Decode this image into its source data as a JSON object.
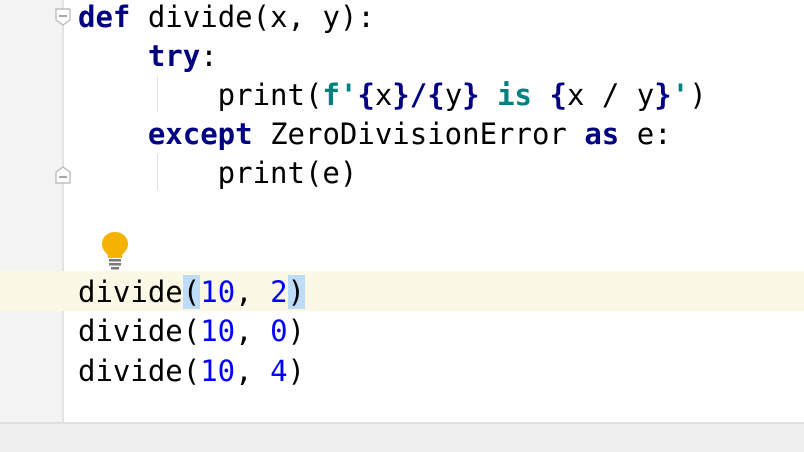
{
  "editor": {
    "lines": [
      [
        {
          "t": "def",
          "c": "kw"
        },
        {
          "t": " divide(x, y):",
          "c": ""
        }
      ],
      [
        {
          "t": "    ",
          "c": ""
        },
        {
          "t": "try",
          "c": "kw"
        },
        {
          "t": ":",
          "c": ""
        }
      ],
      [
        {
          "t": "        print(",
          "c": ""
        },
        {
          "t": "f'",
          "c": "sk"
        },
        {
          "t": "{",
          "c": "kw"
        },
        {
          "t": "x",
          "c": ""
        },
        {
          "t": "}/{",
          "c": "kw"
        },
        {
          "t": "y",
          "c": ""
        },
        {
          "t": "} ",
          "c": "kw"
        },
        {
          "t": "is",
          "c": "sk"
        },
        {
          "t": " ",
          "c": ""
        },
        {
          "t": "{",
          "c": "kw"
        },
        {
          "t": "x / y",
          "c": ""
        },
        {
          "t": "}",
          "c": "kw"
        },
        {
          "t": "'",
          "c": "sk"
        },
        {
          "t": ")",
          "c": ""
        }
      ],
      [
        {
          "t": "    ",
          "c": ""
        },
        {
          "t": "except",
          "c": "kw"
        },
        {
          "t": " ZeroDivisionError ",
          "c": ""
        },
        {
          "t": "as",
          "c": "kw"
        },
        {
          "t": " e:",
          "c": ""
        }
      ],
      [
        {
          "t": "        print(e)",
          "c": ""
        }
      ],
      [],
      [],
      [
        {
          "t": "divide",
          "c": ""
        },
        {
          "t": "(",
          "c": "hl"
        },
        {
          "t": "10",
          "c": "num"
        },
        {
          "t": ", ",
          "c": ""
        },
        {
          "t": "2",
          "c": "num"
        },
        {
          "t": ")",
          "c": "hl"
        }
      ],
      [
        {
          "t": "divide(",
          "c": ""
        },
        {
          "t": "10",
          "c": "num"
        },
        {
          "t": ", ",
          "c": ""
        },
        {
          "t": "0",
          "c": "num"
        },
        {
          "t": ")",
          "c": ""
        }
      ],
      [
        {
          "t": "divide(",
          "c": ""
        },
        {
          "t": "10",
          "c": "num"
        },
        {
          "t": ", ",
          "c": ""
        },
        {
          "t": "4",
          "c": "num"
        },
        {
          "t": ")",
          "c": ""
        }
      ]
    ]
  },
  "colors": {
    "keyword": "#000080",
    "fstring": "#008080",
    "number": "#0000ff",
    "bracket_highlight": "#bcdcf8",
    "current_line": "#fcf8e6",
    "bulb": "#f5b200"
  },
  "icons": [
    "fold-minus-icon",
    "fold-end-icon",
    "lightbulb-icon"
  ]
}
